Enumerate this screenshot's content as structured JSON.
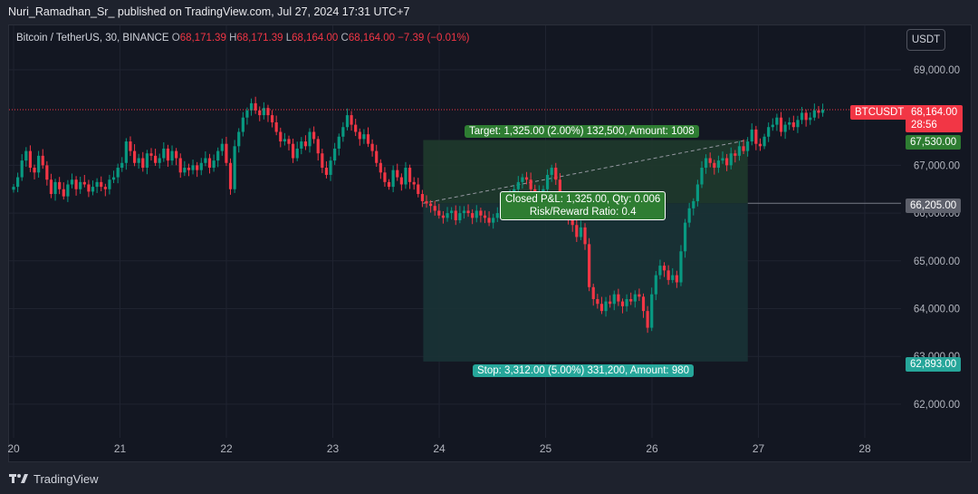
{
  "header": {
    "publisher_line": "Nuri_Ramadhan_Sr_ published on TradingView.com, Jul 27, 2024 17:31 UTC+7"
  },
  "symbol": {
    "title": "Bitcoin / TetherUS, 30, BINANCE",
    "open_label": "O",
    "open": "68,171.39",
    "high_label": "H",
    "high": "68,171.39",
    "low_label": "L",
    "low": "68,164.00",
    "close_label": "C",
    "close": "68,164.00",
    "change": "−7.39 (−0.01%)"
  },
  "currency_button": "USDT",
  "price_axis_labels": [
    "69,000.00",
    "67,000.00",
    "66,000.00",
    "65,000.00",
    "64,000.00",
    "63,000.00",
    "62,000.00"
  ],
  "time_axis_labels": [
    "20",
    "21",
    "22",
    "23",
    "24",
    "25",
    "26",
    "27",
    "28"
  ],
  "tags": {
    "symbol_tag": "BTCUSDT",
    "last_price": "68,164.00",
    "countdown": "28:56",
    "target_price": "67,530.00",
    "entry_price": "66,205.00",
    "stop_price": "62,893.00"
  },
  "position": {
    "target_label": "Target: 1,325.00 (2.00%) 132,500, Amount: 1008",
    "pnl_label": "Closed P&L: 1,325.00, Qty: 0.006",
    "rr_label": "Risk/Reward Ratio: 0.4",
    "stop_label": "Stop: 3,312.00 (5.00%) 331,200, Amount: 980"
  },
  "footer": {
    "brand": "TradingView"
  },
  "colors": {
    "up": "#089981",
    "down": "#f23645",
    "target_zone": "#1f3a2c",
    "stop_zone": "#1a3336",
    "background": "#131722"
  },
  "chart_data": {
    "type": "candlestick",
    "title": "Bitcoin / TetherUS, 30, BINANCE",
    "y_unit": "USDT",
    "ylim": [
      61500,
      69700
    ],
    "x_axis": [
      "20",
      "21",
      "22",
      "23",
      "24",
      "25",
      "26",
      "27",
      "28"
    ],
    "x_range_days": [
      20,
      28.2
    ],
    "last_price": 68164,
    "long_position": {
      "entry": 66205,
      "target": 67530,
      "stop": 62893,
      "start_day": 23.85,
      "end_day": 26.9,
      "exit_day": 26.9,
      "exit_price": 67530
    },
    "candles_close": [
      66550,
      66750,
      67100,
      67300,
      66950,
      66850,
      67200,
      67000,
      66700,
      66400,
      66650,
      66500,
      66350,
      66600,
      66700,
      66500,
      66650,
      66600,
      66450,
      66550,
      66650,
      66550,
      66500,
      66700,
      66750,
      66950,
      67050,
      67500,
      67300,
      67050,
      67150,
      66950,
      67250,
      67200,
      67050,
      67150,
      67350,
      67100,
      67300,
      67150,
      66850,
      66950,
      66900,
      67000,
      66900,
      67050,
      67150,
      66950,
      67100,
      67300,
      67450,
      67050,
      66500,
      67400,
      67700,
      68000,
      68150,
      68300,
      68150,
      68050,
      68200,
      68050,
      67900,
      67700,
      67500,
      67550,
      67450,
      67150,
      67350,
      67500,
      67400,
      67700,
      67550,
      67250,
      66950,
      66800,
      67100,
      67350,
      67600,
      67800,
      68050,
      67850,
      67700,
      67550,
      67650,
      67450,
      67300,
      67050,
      66850,
      66650,
      66550,
      66900,
      66750,
      66600,
      66950,
      66650,
      66600,
      66400,
      66250,
      66200,
      66150,
      66050,
      65950,
      65900,
      66000,
      66050,
      65850,
      66000,
      66050,
      66000,
      65900,
      66050,
      65950,
      65900,
      65800,
      65900,
      66000,
      66150,
      66250,
      66350,
      66500,
      66650,
      66750,
      66700,
      66500,
      66300,
      66450,
      66500,
      66800,
      66950,
      66700,
      66300,
      66150,
      65850,
      65750,
      65500,
      65700,
      65350,
      64450,
      64200,
      64100,
      63950,
      64150,
      64100,
      64300,
      64150,
      64050,
      64200,
      64150,
      64300,
      64250,
      63950,
      63600,
      64300,
      64700,
      64900,
      64800,
      64600,
      64700,
      64550,
      65200,
      65800,
      66100,
      66250,
      66600,
      66950,
      67150,
      67050,
      66950,
      67100,
      67150,
      67000,
      67250,
      67200,
      67400,
      67300,
      67500,
      67750,
      67450,
      67400,
      67600,
      67800,
      67850,
      68000,
      67700,
      67850,
      67900,
      67800,
      67950,
      68100,
      67950,
      68000,
      68150,
      68100,
      68164
    ],
    "candles_start_day": 20.0,
    "candles_step_day": 0.0392
  }
}
